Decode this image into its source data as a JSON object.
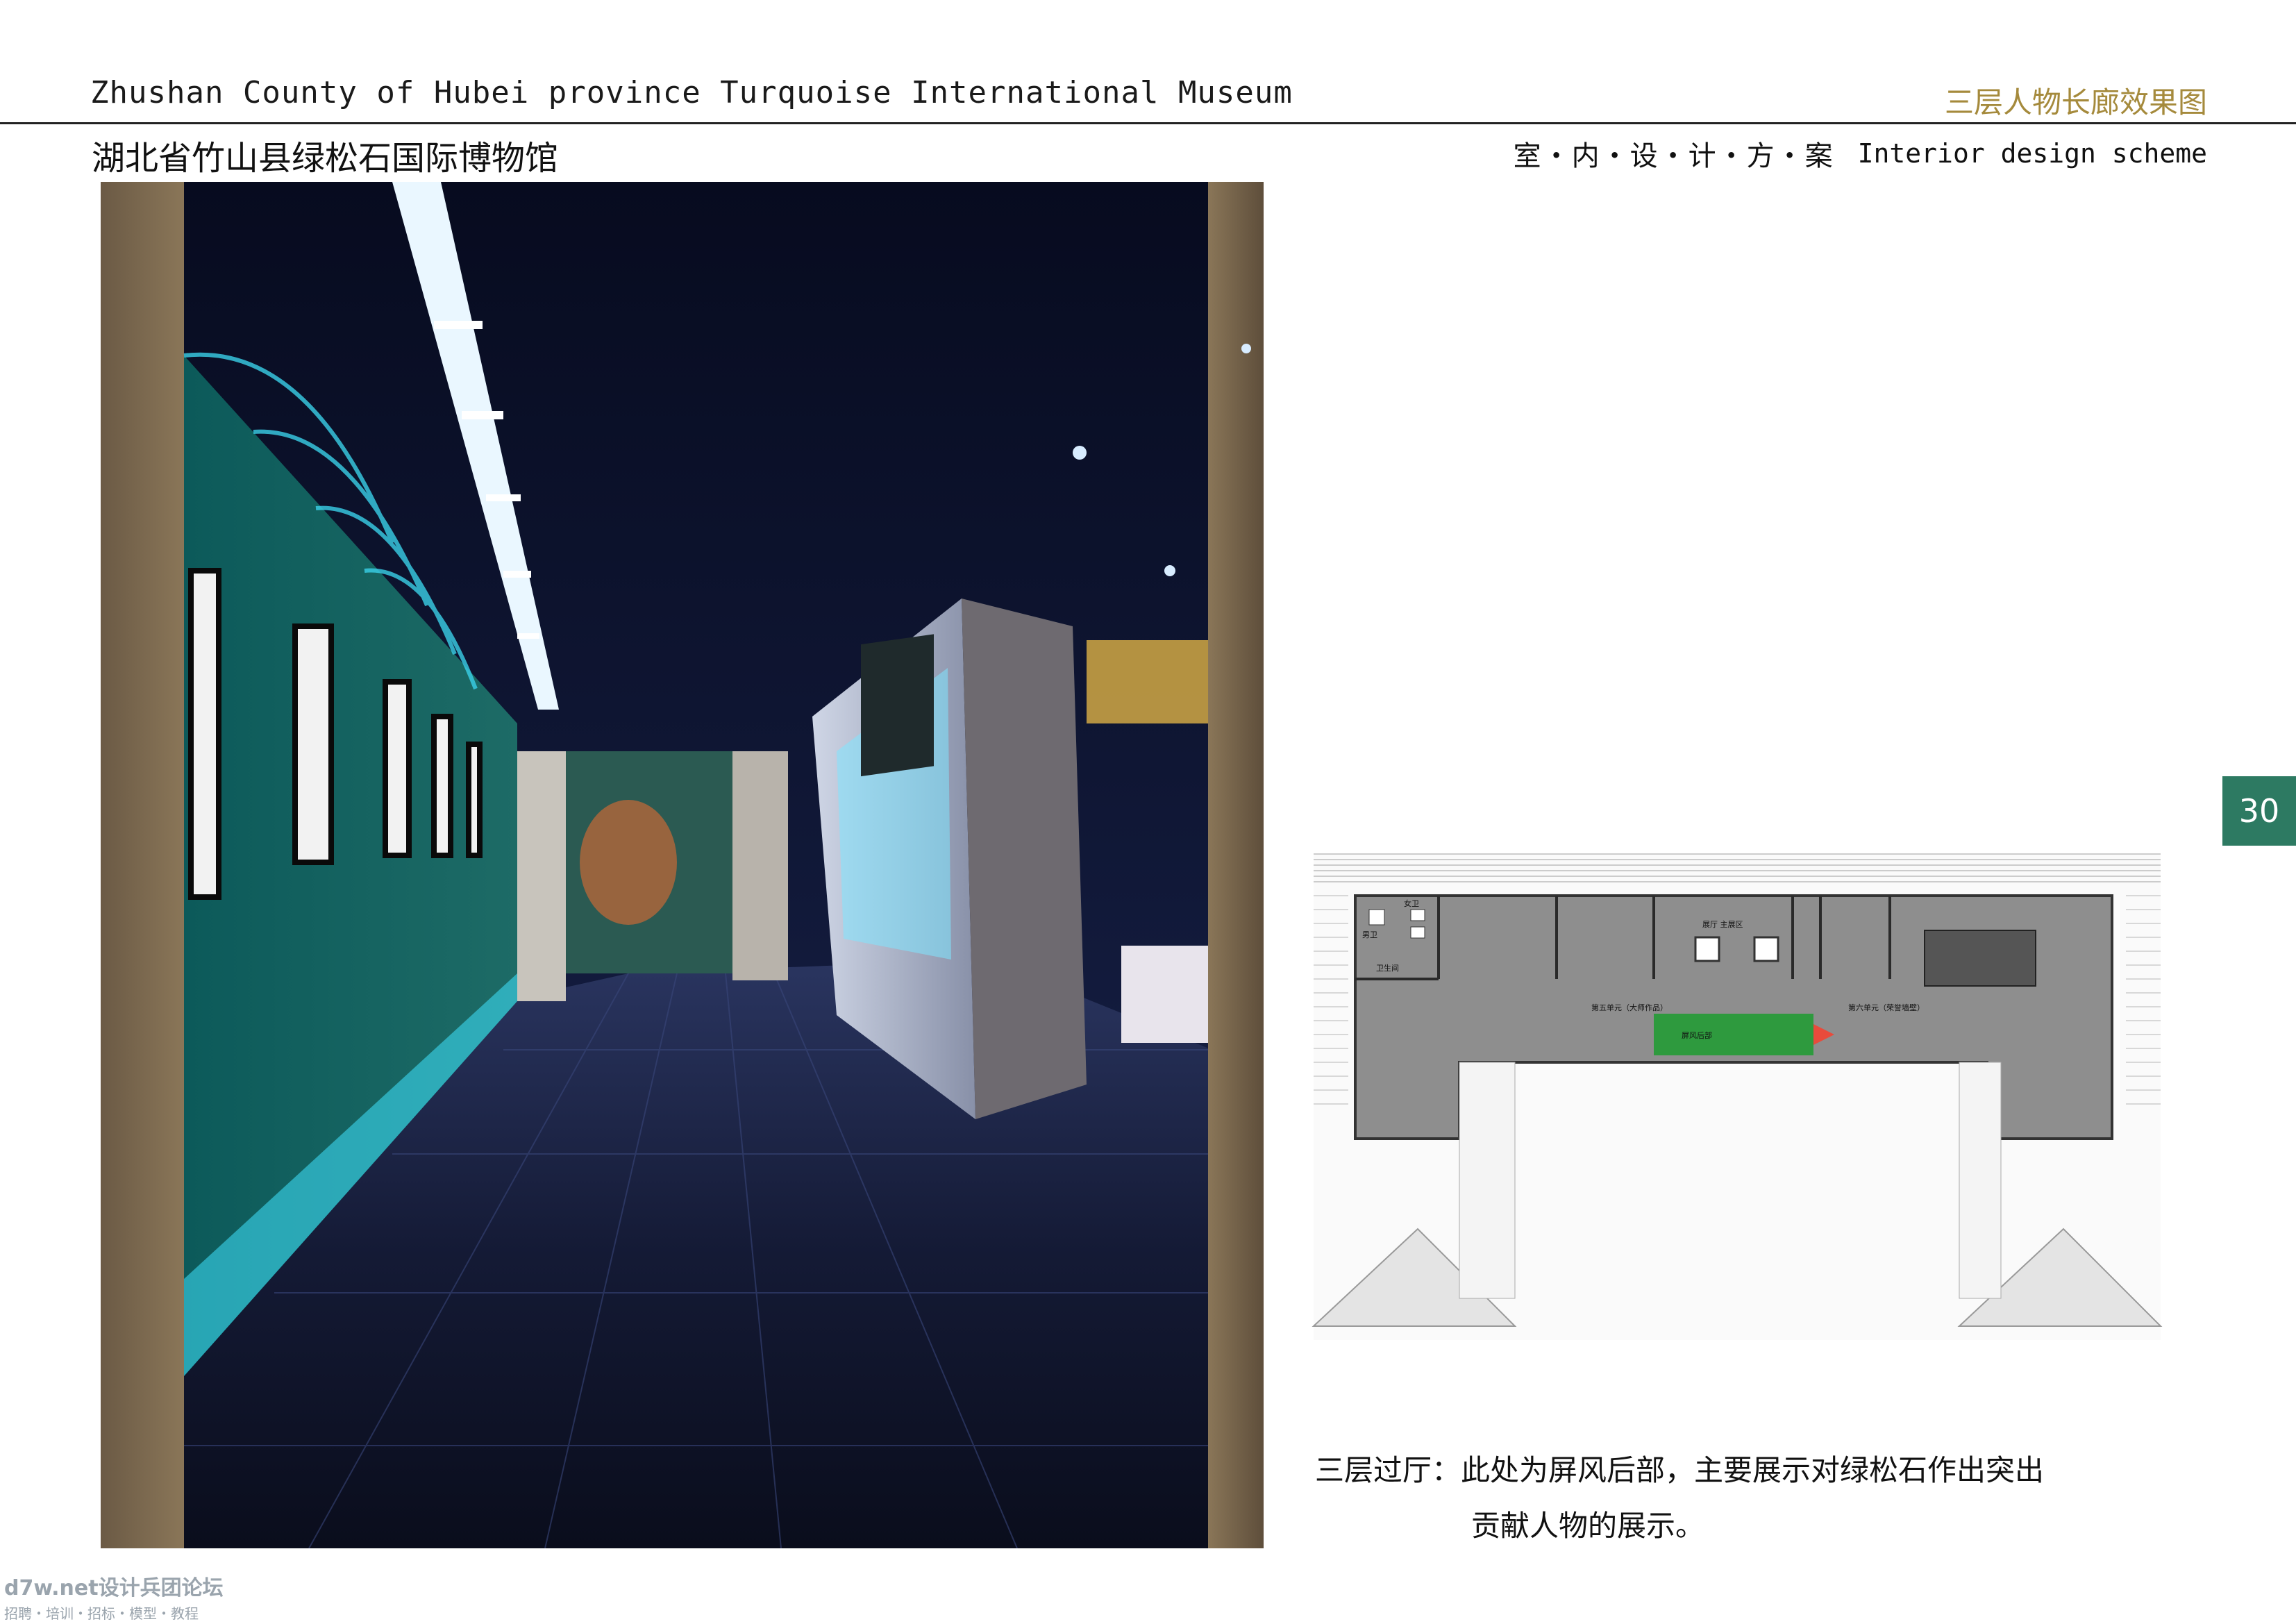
{
  "header": {
    "title_en": "Zhushan County of Hubei province Turquoise International Museum",
    "title_cn": "湖北省竹山县绿松石国际博物馆",
    "sheet_title": "三层人物长廊效果图",
    "scheme_cn": "室・内・设・计・方・案",
    "scheme_en": "Interior design scheme"
  },
  "page_number": "30",
  "caption": {
    "line1": "三层过厅：此处为屏风后部，主要展示对绿松石作出突出",
    "line2": "贡献人物的展示。"
  },
  "plan": {
    "labels": {
      "restroom_m": "男卫",
      "restroom_f": "女卫",
      "restroom": "卫生间",
      "unit5": "第五单元（大师作品）",
      "unit6": "第六单元（荣誉墙壁）",
      "hall": "展厅  主展区",
      "screen": "屏风后部"
    }
  },
  "watermark": {
    "line1": "d7w.net设计兵团论坛",
    "line2": "招聘・培训・招标・模型・教程"
  },
  "colors": {
    "accent_green": "#2d7a62",
    "gold": "#a58a3c"
  }
}
